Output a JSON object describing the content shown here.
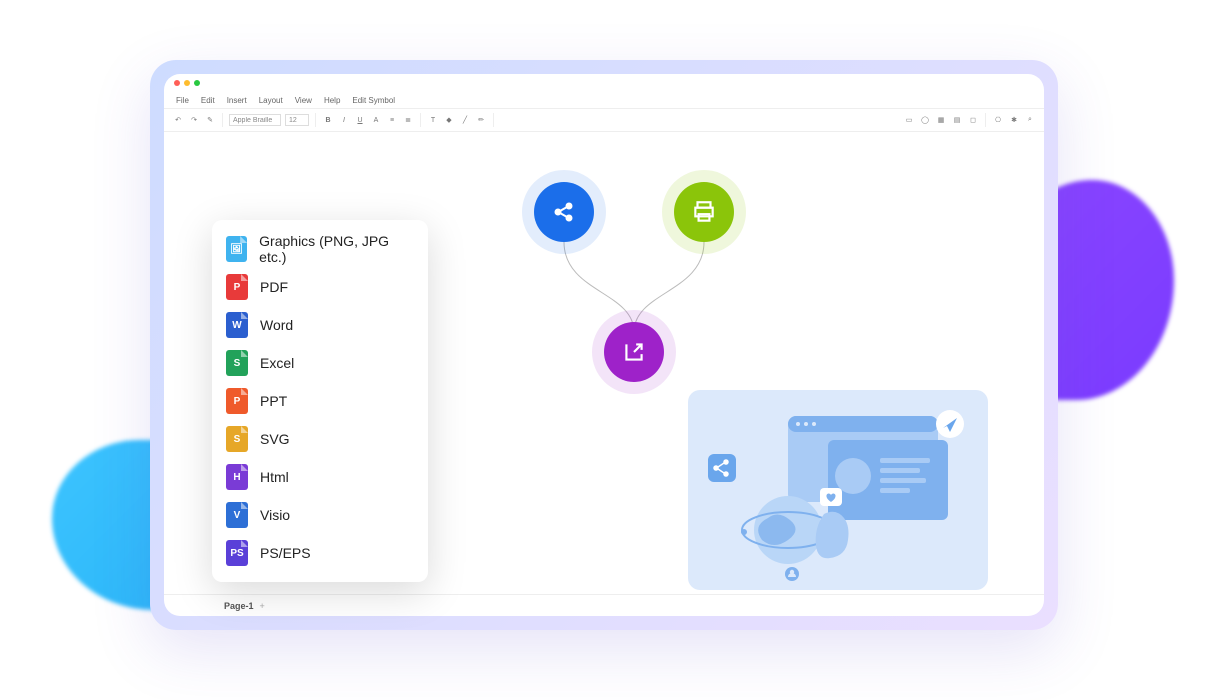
{
  "menubar": [
    "File",
    "Edit",
    "Insert",
    "Layout",
    "View",
    "Help",
    "Edit Symbol"
  ],
  "toolbar": {
    "font_name": "Apple Braille",
    "font_size": "12"
  },
  "pages": {
    "active": "Page-1",
    "add_label": "+"
  },
  "export_options": [
    {
      "label": "Graphics (PNG, JPG etc.)",
      "color": "#3fb3ef",
      "glyph": "🖼"
    },
    {
      "label": "PDF",
      "color": "#e83a3a",
      "glyph": "P"
    },
    {
      "label": "Word",
      "color": "#2b5fcf",
      "glyph": "W"
    },
    {
      "label": "Excel",
      "color": "#22a25a",
      "glyph": "S"
    },
    {
      "label": "PPT",
      "color": "#ef5a2b",
      "glyph": "P"
    },
    {
      "label": "SVG",
      "color": "#e6a728",
      "glyph": "S"
    },
    {
      "label": "Html",
      "color": "#7a3bd6",
      "glyph": "H"
    },
    {
      "label": "Visio",
      "color": "#2d6fd6",
      "glyph": "V"
    },
    {
      "label": "PS/EPS",
      "color": "#5a40d8",
      "glyph": "PS"
    }
  ],
  "diagram_nodes": {
    "blue": "share",
    "green": "print",
    "purple": "export"
  }
}
